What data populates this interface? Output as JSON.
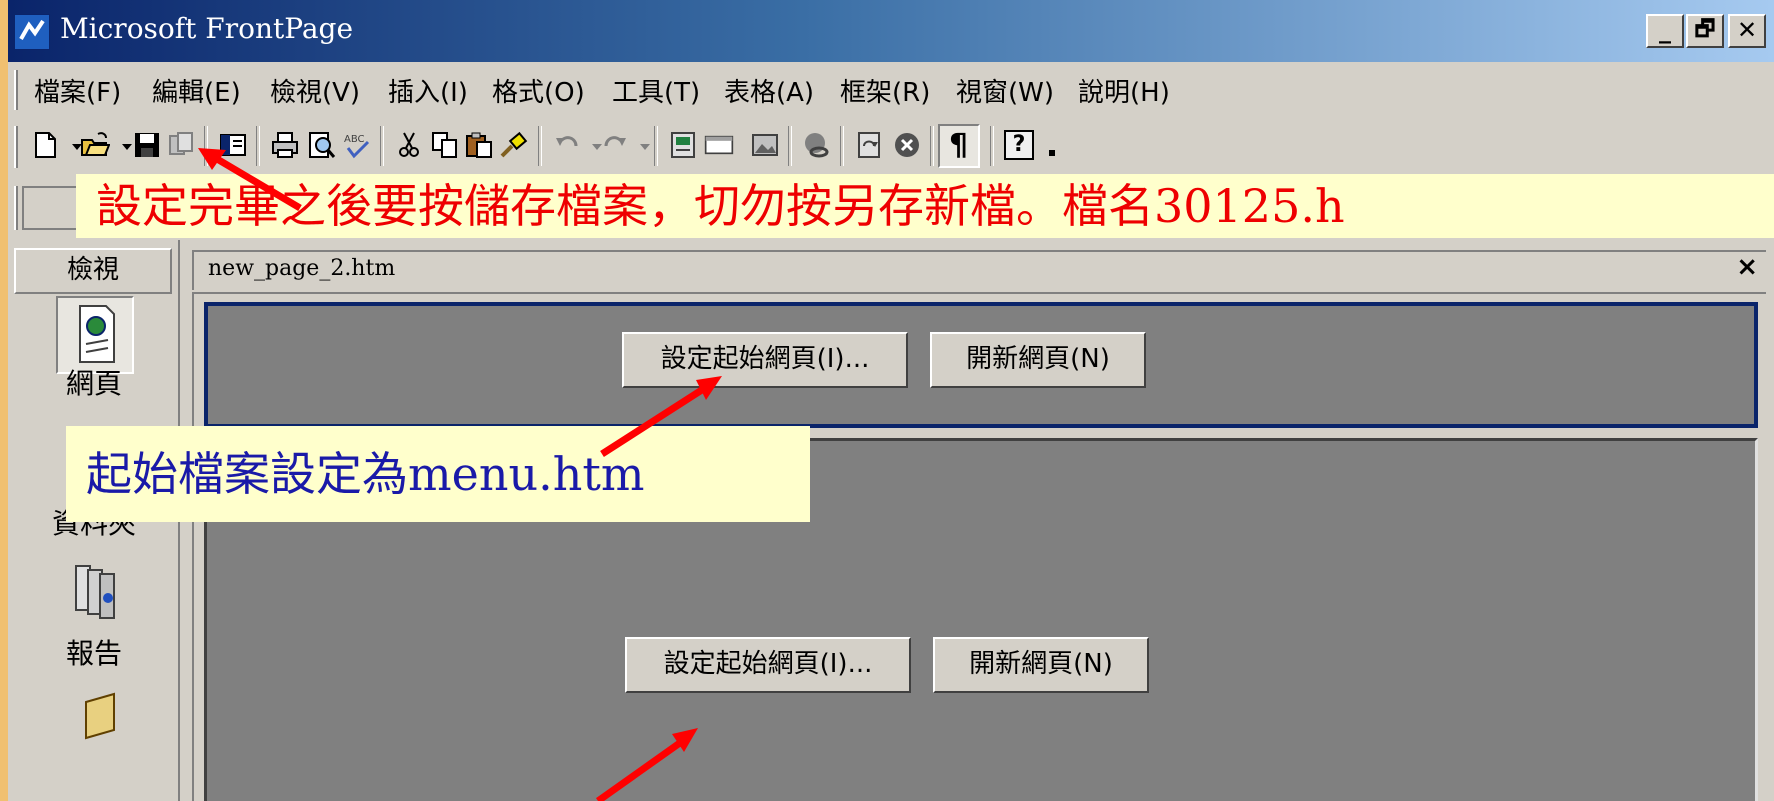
{
  "window": {
    "title": "Microsoft FrontPage",
    "controls": {
      "minimize": "_",
      "restore": "🗗",
      "close": "✕"
    }
  },
  "menu": {
    "items": [
      "檔案(F)",
      "編輯(E)",
      "檢視(V)",
      "插入(I)",
      "格式(O)",
      "工具(T)",
      "表格(A)",
      "框架(R)",
      "視窗(W)",
      "說明(H)"
    ]
  },
  "toolbar": {
    "icons": [
      "new-page-icon",
      "dropdown-arrow-icon",
      "open-folder-icon",
      "dropdown-arrow-icon",
      "save-icon",
      "publish-icon",
      "folder-list-icon",
      "print-icon",
      "print-preview-icon",
      "spelling-icon",
      "cut-icon",
      "copy-icon",
      "paste-icon",
      "format-painter-icon",
      "undo-icon",
      "redo-icon",
      "insert-component-icon",
      "insert-table-icon",
      "insert-picture-icon",
      "hyperlink-icon",
      "refresh-icon",
      "stop-icon",
      "show-all-icon",
      "help-icon"
    ],
    "show_all_glyph": "¶",
    "help_glyph": "?"
  },
  "views_bar": {
    "header": "檢視",
    "items": [
      {
        "label": "網頁",
        "icon": "page-view-icon",
        "selected": true
      },
      {
        "label": "資料夾",
        "icon": "folder-view-icon",
        "selected": false
      },
      {
        "label": "報告",
        "icon": "reports-view-icon",
        "selected": false
      }
    ]
  },
  "document": {
    "tab_name": "new_page_2.htm",
    "close_glyph": "×",
    "frames": [
      {
        "set_initial_page": "設定起始網頁(I)...",
        "new_page": "開新網頁(N)"
      },
      {
        "set_initial_page": "設定起始網頁(I)...",
        "new_page": "開新網頁(N)"
      }
    ]
  },
  "callouts": {
    "save_note": "設定完畢之後要按儲存檔案，切勿按另存新檔。檔名30125.h",
    "initial_file_note": "起始檔案設定為menu.htm"
  },
  "colors": {
    "title_bar_start": "#0a246a",
    "title_bar_end": "#a6caf0",
    "callout_background": "#ffffcc",
    "save_note_text": "#ee0000",
    "initial_file_note_text": "#1a1aa8",
    "arrow": "#ff0000",
    "frame_background": "#808080"
  }
}
